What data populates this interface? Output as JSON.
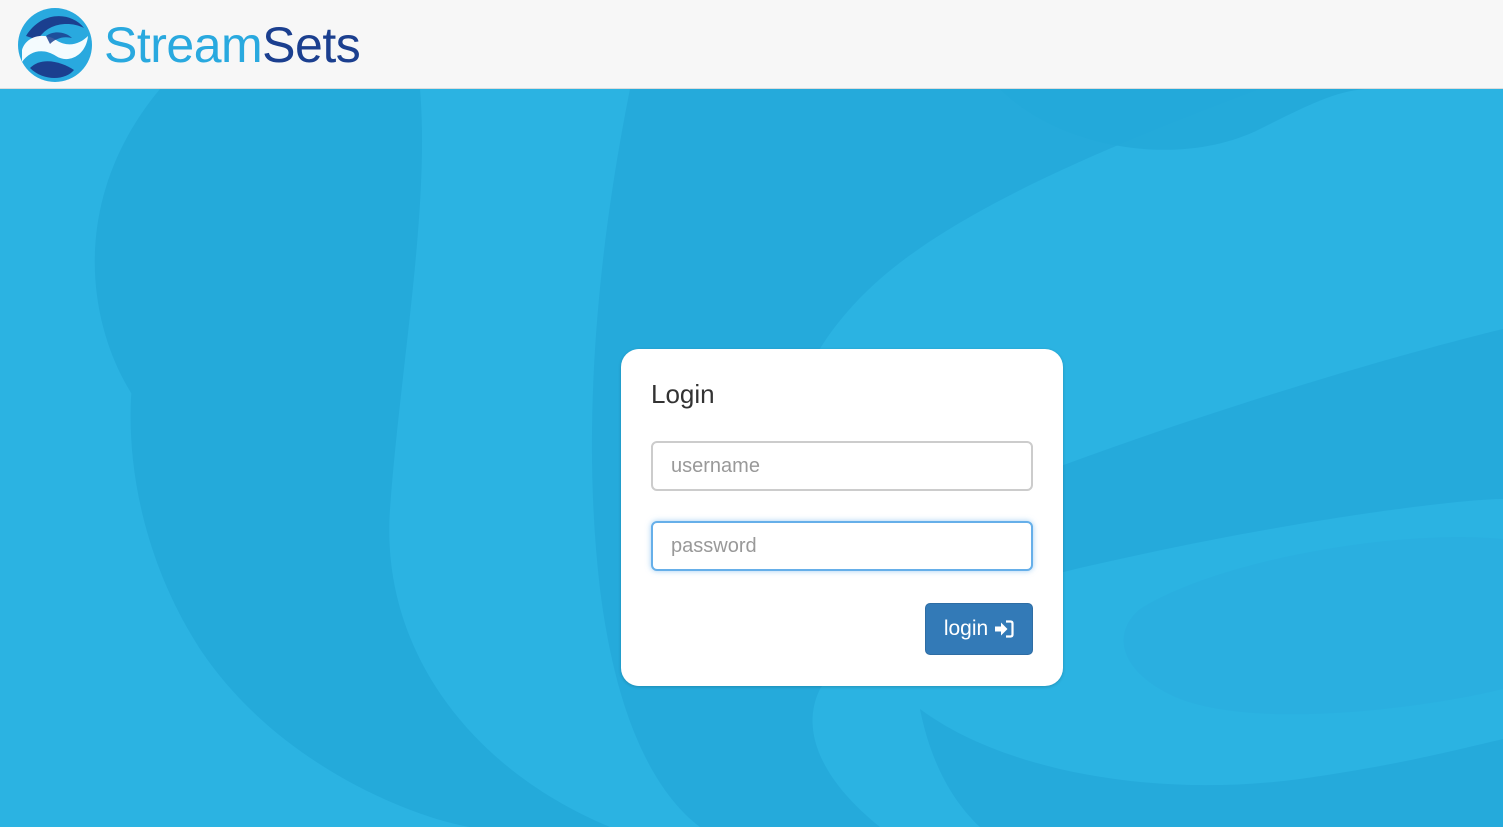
{
  "header": {
    "brand_part1": "Stream",
    "brand_part2": "Sets",
    "logo_icon": "streamsets-logo-icon"
  },
  "login": {
    "title": "Login",
    "username_placeholder": "username",
    "password_placeholder": "password",
    "button_label": "login",
    "button_icon": "sign-in-icon"
  },
  "colors": {
    "background": "#2bb3e2",
    "header_bg": "#f7f7f7",
    "brand_light": "#29a9df",
    "brand_dark": "#1b3f8f",
    "button_bg": "#337ab7",
    "focus_border": "#66afe9"
  }
}
